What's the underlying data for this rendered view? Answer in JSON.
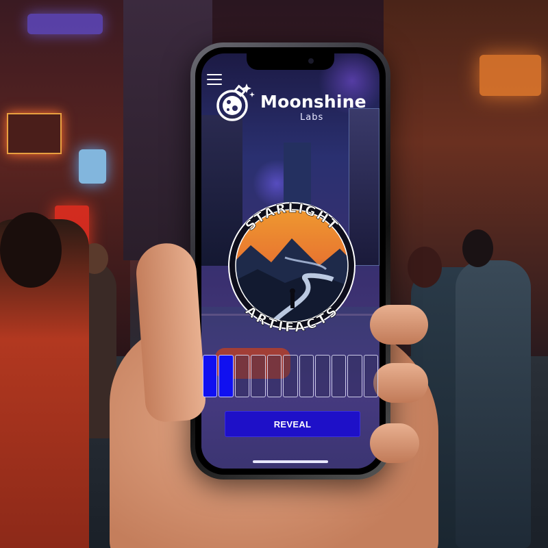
{
  "app": {
    "brand_name": "Moonshine",
    "brand_sub": "Labs"
  },
  "badge": {
    "top_text": "STARLIGHT",
    "bottom_text": "ARTIFACTS"
  },
  "progress": {
    "total_slots": 11,
    "filled_slots": 2,
    "fraction": 0.18
  },
  "actions": {
    "reveal_label": "REVEAL"
  },
  "icons": {
    "menu": "hamburger-menu-icon",
    "brand": "flask-moon-icon"
  },
  "colors": {
    "accent": "#1e10c8",
    "slot_filled": "#1010f0",
    "text": "#ffffff"
  }
}
